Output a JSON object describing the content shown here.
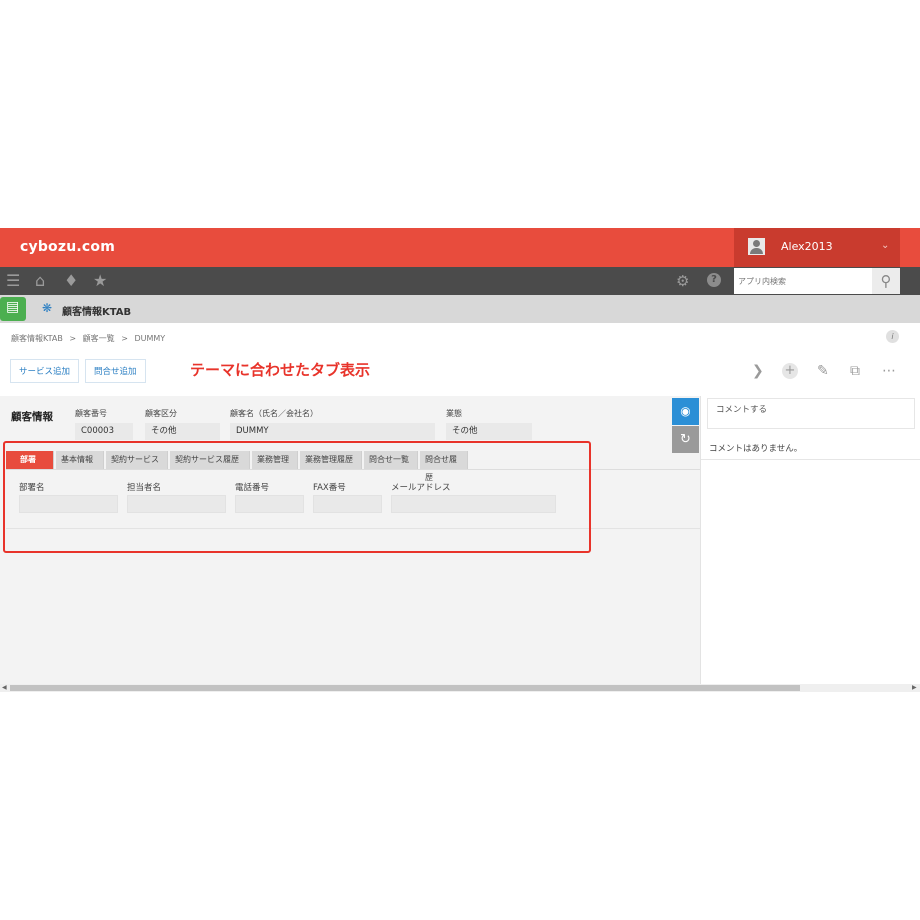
{
  "header": {
    "logo": "cybozu.com",
    "user": "Alex2013",
    "search_placeholder": "アプリ内検索"
  },
  "app": {
    "title": "顧客情報KTAB",
    "breadcrumb": [
      "顧客情報KTAB",
      ">",
      "顧客一覧",
      ">",
      "DUMMY"
    ]
  },
  "toolbar": {
    "buttons": [
      "サービス追加",
      "問合せ追加"
    ],
    "annotation": "テーマに合わせたタブ表示"
  },
  "record": {
    "group_title": "顧客情報",
    "fields": [
      {
        "label": "顧客番号",
        "value": "C00003"
      },
      {
        "label": "顧客区分",
        "value": "その他"
      },
      {
        "label": "顧客名（氏名／会社名）",
        "value": "DUMMY"
      },
      {
        "label": "業態",
        "value": "その他"
      }
    ]
  },
  "tabs": [
    "部署",
    "基本情報",
    "契約サービス",
    "契約サービス履歴",
    "業務管理",
    "業務管理履歴",
    "問合せ一覧",
    "問合せ履歴"
  ],
  "subfields": [
    "部署名",
    "担当者名",
    "電話番号",
    "FAX番号",
    "メールアドレス"
  ],
  "comments": {
    "placeholder": "コメントする",
    "empty": "コメントはありません。"
  },
  "colors": {
    "accent": "#e84c3d",
    "nav": "#4b4b4b",
    "link": "#2b7fc3",
    "annotation": "#e8332a"
  }
}
